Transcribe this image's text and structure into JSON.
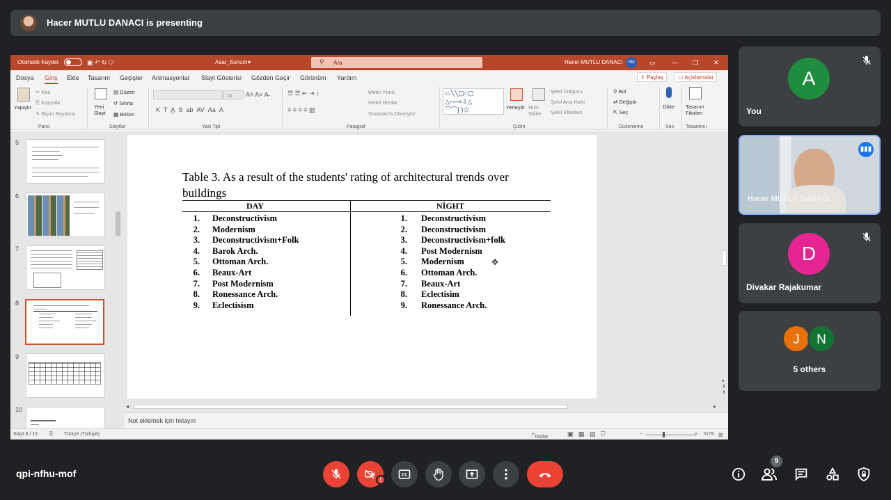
{
  "banner": {
    "text": "Hacer MUTLU DANACI is presenting"
  },
  "ppt": {
    "titlebar": {
      "autosave": "Otomatik Kaydet",
      "filename": "Asar_Sunum",
      "search": "Ara",
      "user": "Hacer MUTLU DANACI",
      "user_initials": "HM"
    },
    "menu": [
      "Dosya",
      "Giriş",
      "Ekle",
      "Tasarım",
      "Geçişler",
      "Animasyonlar",
      "Slayt Gösterisi",
      "Gözden Geçir",
      "Görünüm",
      "Yardım"
    ],
    "share": "Paylaş",
    "comments": "Açıklamalar",
    "ribbon": {
      "paste": "Yapıştır",
      "cut": "Kes",
      "copy": "Kopyala",
      "format_painter": "Biçim Boyacısı",
      "new_slide": "Yeni Slayt",
      "layout": "Düzen",
      "reset": "Sıfırla",
      "section": "Bölüm",
      "font_size": "18",
      "text_direction": "Metin Yönü",
      "align_text": "Metni Hizala",
      "smartart": "SmartArt'a Dönüştür",
      "arrange": "Yerleştir",
      "quick_styles": "Hızlı Stiller",
      "shape_fill": "Şekil Dolgusu",
      "shape_outline": "Şekil Ana Hattı",
      "shape_effects": "Şekil Efektleri",
      "find": "Bul",
      "replace": "Değiştir",
      "select": "Seç",
      "dictate": "Dikte",
      "design_ideas": "Tasarım Fikirleri",
      "groups": {
        "clipboard": "Pano",
        "slides": "Slaytlar",
        "font": "Yazı Tipi",
        "paragraph": "Paragraf",
        "drawing": "Çizim",
        "editing": "Düzenleme",
        "voice": "Ses",
        "designer": "Tasarımcı"
      }
    },
    "slide_numbers": [
      "5",
      "6",
      "7",
      "8",
      "9",
      "10"
    ],
    "slide": {
      "title": "Table 3. As a result of the students' rating of architectural trends over buildings",
      "col_day": "DAY",
      "col_night": "NİGHT",
      "day": [
        {
          "n": "1.",
          "v": "Deconstructivism"
        },
        {
          "n": "2.",
          "v": "Modernism"
        },
        {
          "n": "3.",
          "v": "Deconstructivism+Folk"
        },
        {
          "n": "4.",
          "v": "Barok Arch."
        },
        {
          "n": "5.",
          "v": "Ottoman Arch."
        },
        {
          "n": "6.",
          "v": "Beaux-Art"
        },
        {
          "n": "7.",
          "v": "Post Modernism"
        },
        {
          "n": "8.",
          "v": "Ronessance Arch."
        },
        {
          "n": "9.",
          "v": "Eclectisism"
        }
      ],
      "night": [
        {
          "n": "1.",
          "v": "Deconstructivism"
        },
        {
          "n": "2.",
          "v": "Deconstructivism"
        },
        {
          "n": "3.",
          "v": "Deconstructivism+folk"
        },
        {
          "n": "4.",
          "v": "Post Modernism"
        },
        {
          "n": "5.",
          "v": "Modernism"
        },
        {
          "n": "6.",
          "v": "Ottoman Arch."
        },
        {
          "n": "7.",
          "v": "Beaux-Art"
        },
        {
          "n": "8.",
          "v": "Eclectisim"
        },
        {
          "n": "9.",
          "v": "Ronessance Arch."
        }
      ]
    },
    "notes_placeholder": "Not eklemek için tıklayın",
    "status": {
      "slide_count": "Slayt 8 / 15",
      "language": "Türkçe (Türkiye)",
      "notes": "Notlar",
      "zoom": "%79"
    }
  },
  "participants": [
    {
      "name": "You",
      "initial": "A",
      "color": "#1e8e3e",
      "muted": true
    },
    {
      "name": "Hacer MUTLU DANACI",
      "speaking": true
    },
    {
      "name": "Divakar Rajakumar",
      "initial": "D",
      "color": "#e52592",
      "muted": true
    },
    {
      "name": "5 others",
      "initials": [
        "J",
        "N"
      ],
      "colors": [
        "#e8710a",
        "#137333"
      ]
    }
  ],
  "meeting": {
    "code": "qpi-nfhu-mof",
    "people_count": "9"
  },
  "colors": {
    "accent": "#b7472a",
    "meet_bg": "#202124",
    "tile_bg": "#3c4043",
    "end_call": "#ea4335"
  }
}
